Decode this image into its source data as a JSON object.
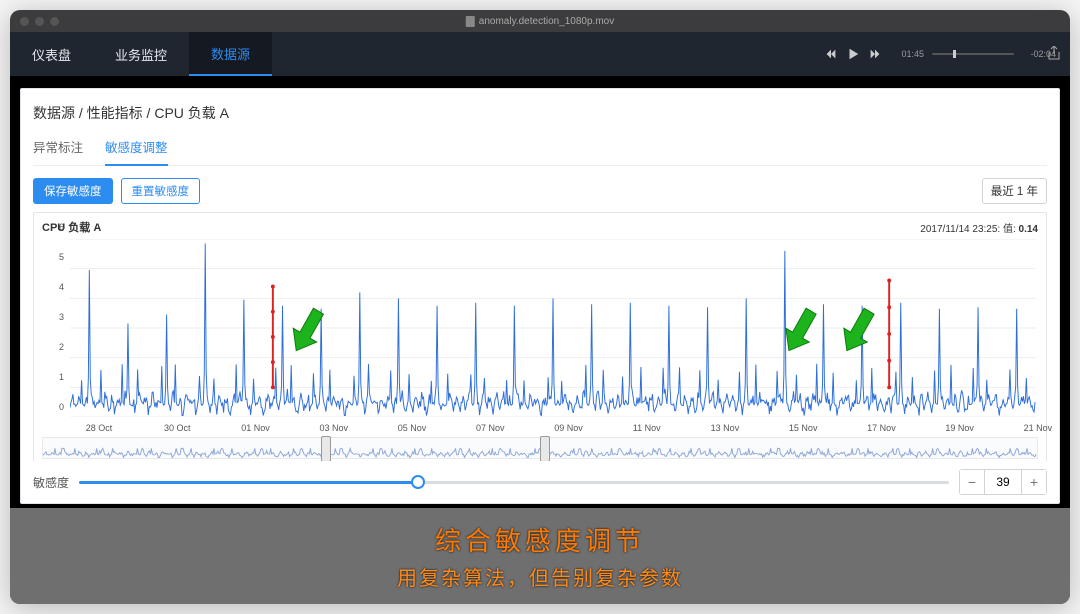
{
  "player": {
    "filename": "anomaly.detection_1080p.mov",
    "elapsed": "01:45",
    "remaining": "-02:04"
  },
  "nav": {
    "items": [
      "仪表盘",
      "业务监控",
      "数据源"
    ],
    "active_index": 2
  },
  "breadcrumb": "数据源 / 性能指标 / CPU 负载 A",
  "subtabs": {
    "items": [
      "异常标注",
      "敏感度调整"
    ],
    "active_index": 1
  },
  "toolbar": {
    "save_label": "保存敏感度",
    "reset_label": "重置敏感度",
    "range_label": "最近 1 年"
  },
  "chart": {
    "title": "CPU 负载 A",
    "hover_time": "2017/11/14 23:25",
    "hover_value_label": "值",
    "hover_value": "0.14"
  },
  "chart_data": {
    "type": "line",
    "title": "CPU 负载 A",
    "xlabel": "",
    "ylabel": "",
    "ylim": [
      0,
      6
    ],
    "y_ticks": [
      0,
      1,
      2,
      3,
      4,
      5,
      6
    ],
    "x_ticks": [
      "28 Oct",
      "30 Oct",
      "01 Nov",
      "03 Nov",
      "05 Nov",
      "07 Nov",
      "09 Nov",
      "11 Nov",
      "13 Nov",
      "15 Nov",
      "17 Nov",
      "19 Nov",
      "21 Nov"
    ],
    "x_tick_positions_pct": [
      3.0,
      11.1,
      19.2,
      27.3,
      35.4,
      43.5,
      51.6,
      59.7,
      67.8,
      75.9,
      84.0,
      92.1,
      100.2
    ],
    "daily_peaks_approx": [
      4.95,
      3.15,
      3.45,
      5.85,
      3.95,
      3.75,
      3.65,
      4.2,
      4.0,
      3.75,
      3.85,
      3.75,
      4.0,
      3.8,
      3.85,
      3.75,
      3.7,
      4.0,
      5.6,
      3.8,
      3.75,
      3.85,
      3.65,
      3.7,
      3.65
    ],
    "baseline_range": [
      0.1,
      1.0
    ],
    "anomalies_x_pct": [
      21.0,
      84.8
    ],
    "anomalies_ymax": [
      4.4,
      4.6
    ],
    "highlight_arrows_x_pct": [
      26,
      77,
      83
    ]
  },
  "sensitivity": {
    "label": "敏感度",
    "value": 39,
    "min": 0,
    "max": 100
  },
  "caption": {
    "line1": "综合敏感度调节",
    "line2": "用复杂算法，但告别复杂参数"
  }
}
